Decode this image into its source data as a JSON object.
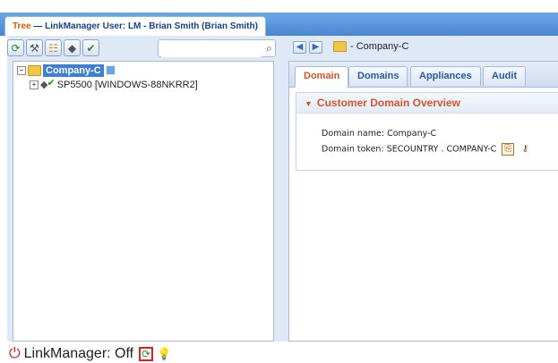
{
  "window": {
    "tab_prefix": "Tree",
    "tab_title": "— LinkManager User: LM - Brian Smith (Brian Smith)"
  },
  "left_toolbar": {
    "icons": [
      "refresh-icon",
      "wand-icon",
      "tree-icon",
      "appliance-icon",
      "check-icon"
    ],
    "search": {
      "value": "",
      "placeholder": ""
    }
  },
  "tree": {
    "root": {
      "label": "Company-C",
      "expander": "−"
    },
    "child": {
      "label": "SP5500 [WINDOWS-88NKRR2]",
      "expander": "+"
    }
  },
  "breadcrumb": {
    "label": "- Company-C"
  },
  "tabs": [
    {
      "label": "Domain",
      "active": true
    },
    {
      "label": "Domains",
      "active": false
    },
    {
      "label": "Appliances",
      "active": false
    },
    {
      "label": "Audit",
      "active": false
    }
  ],
  "overview": {
    "title": "Customer Domain Overview",
    "domain_name_label": "Domain name:",
    "domain_name_value": "Company-C",
    "domain_token_label": "Domain token:",
    "domain_token_value": "SECOUNTRY . COMPANY-C"
  },
  "status": {
    "text": "LinkManager: Off"
  },
  "colors": {
    "accent_blue": "#4a86d0",
    "active_tab": "#d9542a",
    "selection": "#3d7fd5",
    "power_off": "#c0201a"
  }
}
